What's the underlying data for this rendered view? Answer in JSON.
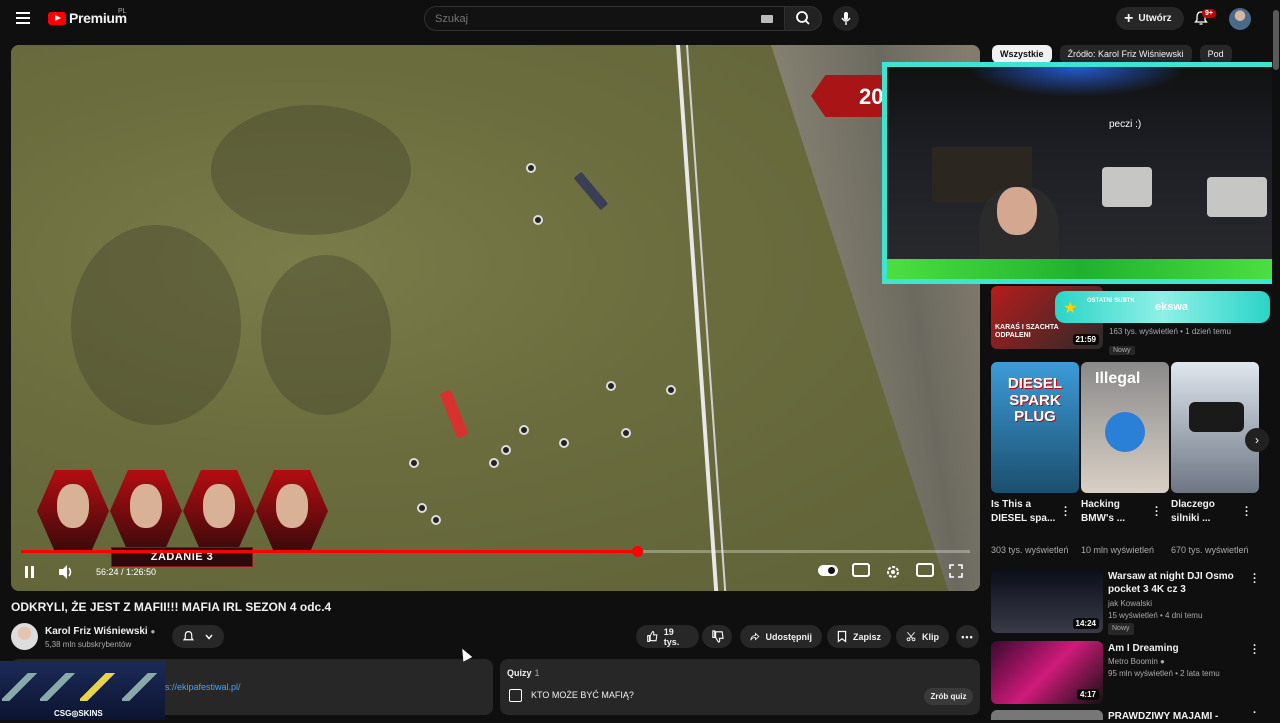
{
  "header": {
    "logo_text": "Premium",
    "logo_country": "PL",
    "search_placeholder": "Szukaj",
    "create_label": "Utwórz",
    "notifications_badge": "9+"
  },
  "player": {
    "overlay_number": "20:",
    "task_label": "ZADANIE 3",
    "time": "56:24 / 1:26:50",
    "progress_fraction": 0.6496
  },
  "webcam": {
    "caption": "peczi :)",
    "sub_badge_label": "OSTATNI SUBTK",
    "sub_badge_name": "ekswa"
  },
  "sidebar": {
    "chips": [
      "Wszystkie",
      "Źródło: Karol Friz Wiśniewski",
      "Pod"
    ],
    "top_video": {
      "thumb_text": "KARAŚ I SZACHTA ODPALENI",
      "duration": "21:59",
      "meta": "163 tys. wyświetleń • 1 dzień temu",
      "badge": "Nowy"
    },
    "shorts": [
      {
        "thumb_text": "DIESEL SPARK PLUG",
        "title": "Is This a DIESEL spa...",
        "views": "303 tys. wyświetleń"
      },
      {
        "thumb_text": "Illegal",
        "title": "Hacking BMW's ...",
        "views": "10 mln wyświetleń"
      },
      {
        "thumb_text": "",
        "title": "Dlaczego silniki ...",
        "views": "670 tys. wyświetleń"
      }
    ],
    "videos": [
      {
        "title": "Warsaw at night  DJI Osmo pocket 3 4K cz  3",
        "channel": "jak Kowalski",
        "meta": "15 wyświetleń • 4 dni temu",
        "badge": "Nowy",
        "duration": "14:24"
      },
      {
        "title": "Am I Dreaming",
        "channel": "Metro Boomin",
        "meta": "95 mln wyświetleń • 2 lata temu",
        "badge": "",
        "duration": "4:17"
      },
      {
        "title": "PRAWDZIWY MAJAMI -",
        "channel": "",
        "meta": "",
        "badge": "",
        "duration": ""
      }
    ]
  },
  "video": {
    "title": "ODKRYLI, ŻE JEST Z MAFII!!! MAFIA IRL SEZON 4 odc.4",
    "channel_name": "Karol Friz Wiśniewski",
    "subscribers": "5,38 mln subskrybentów",
    "likes": "19 tys.",
    "share_label": "Udostępnij",
    "save_label": "Zapisz",
    "clip_label": "Klip"
  },
  "description": {
    "heading": "u",
    "link": "ps://ekipafestiwal.pl/",
    "sponsor": "CSG◎SKINS"
  },
  "quiz": {
    "title": "Quizy",
    "count": "1",
    "question": "KTO MOŻE BYĆ MAFIĄ?",
    "button": "Zrób quiz"
  }
}
